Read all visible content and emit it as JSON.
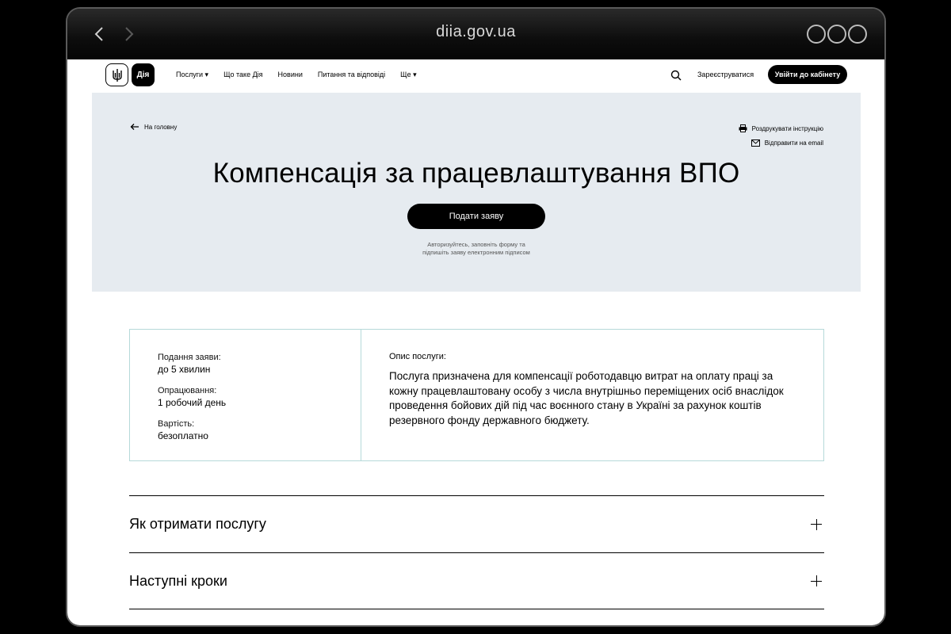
{
  "browser": {
    "url": "diia.gov.ua"
  },
  "header": {
    "logo_text": "Дія",
    "menu": [
      "Послуги ▾",
      "Що таке Дія",
      "Новини",
      "Питання та відповіді",
      "Ще ▾"
    ],
    "register_label": "Зареєструватися",
    "login_label": "Увійти до кабінету"
  },
  "hero": {
    "back_label": "На головну",
    "print_label": "Роздрукувати інструкцію",
    "email_label": "Відправити на email",
    "title": "Компенсація за працевлаштування ВПО",
    "apply_label": "Подати заяву",
    "hint_line1": "Авторизуйтесь, заповніть форму та",
    "hint_line2": "підпишіть заяву електронним підписом"
  },
  "info": {
    "submit_label": "Подання заяви:",
    "submit_value": "до 5 хвилин",
    "processing_label": "Опрацювання:",
    "processing_value": "1 робочий день",
    "cost_label": "Вартість:",
    "cost_value": "безоплатно",
    "description_label": "Опис послуги:",
    "description_line1": "Послуга призначена для компенсації роботодавцю витрат на оплату праці за",
    "description_line2": "кожну працевлаштовану особу з числа внутрішньо переміщених осіб внаслідок",
    "description_line3": "проведення бойових дій під час воєнного стану в Україні за рахунок коштів",
    "description_line4": "резервного фонду державного бюджету."
  },
  "accordion": {
    "item1": "Як отримати послугу",
    "item2": "Наступні кроки"
  }
}
